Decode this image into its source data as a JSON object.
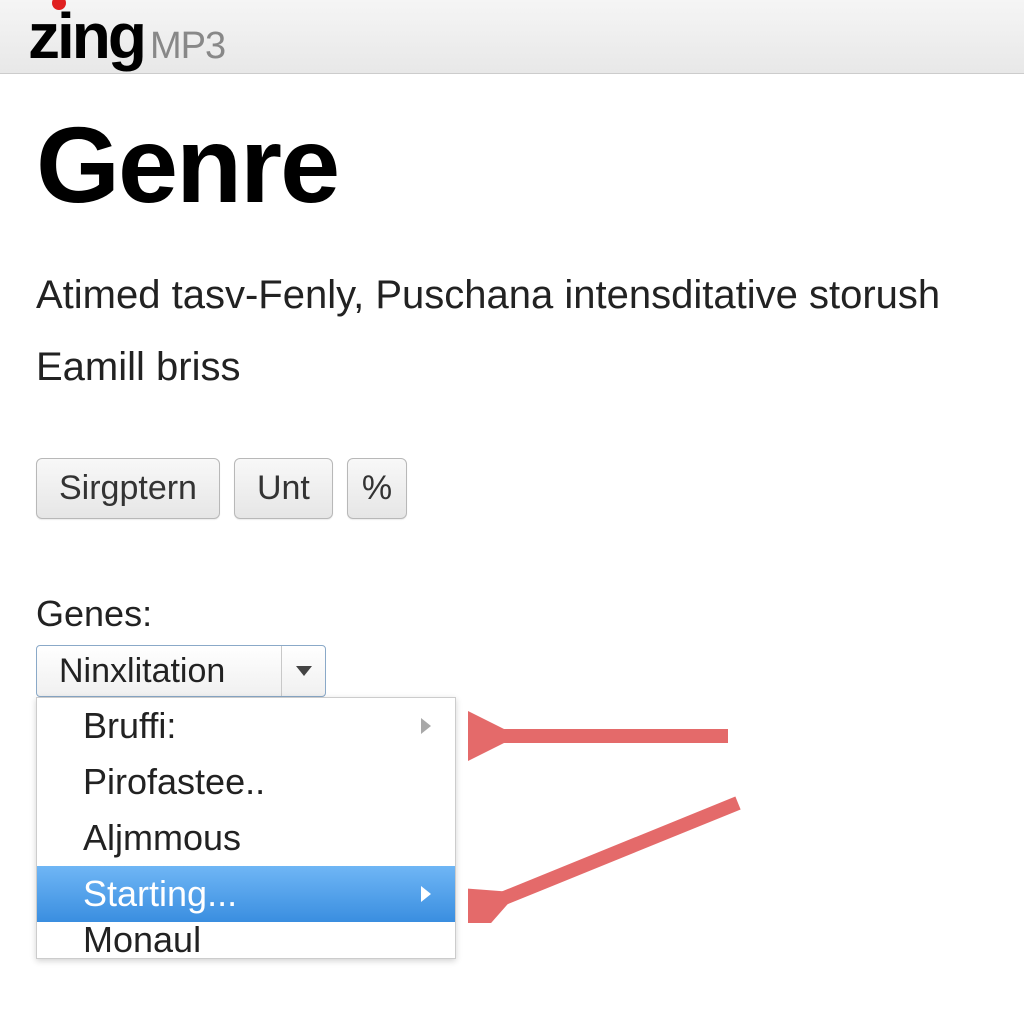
{
  "header": {
    "logo_main": "zing",
    "logo_suffix": "MP3"
  },
  "page": {
    "title": "Genre",
    "description_line1": "Atimed tasv-Fenly, Puschana intensditative storush",
    "description_line2": "Eamill briss"
  },
  "buttons": {
    "button1": "Sirgptern",
    "button2": "Unt",
    "button3": "%"
  },
  "dropdown": {
    "label": "Genes:",
    "selected": "Ninxlitation",
    "items": [
      {
        "label": "Bruffi:",
        "has_submenu": true,
        "highlighted": false
      },
      {
        "label": "Pirofastee..",
        "has_submenu": false,
        "highlighted": false
      },
      {
        "label": "Aljmmous",
        "has_submenu": false,
        "highlighted": false
      },
      {
        "label": "Starting...",
        "has_submenu": true,
        "highlighted": true
      },
      {
        "label": "Monaul",
        "has_submenu": false,
        "highlighted": false
      }
    ]
  },
  "annotations": {
    "arrow_color": "#e46a6a"
  }
}
